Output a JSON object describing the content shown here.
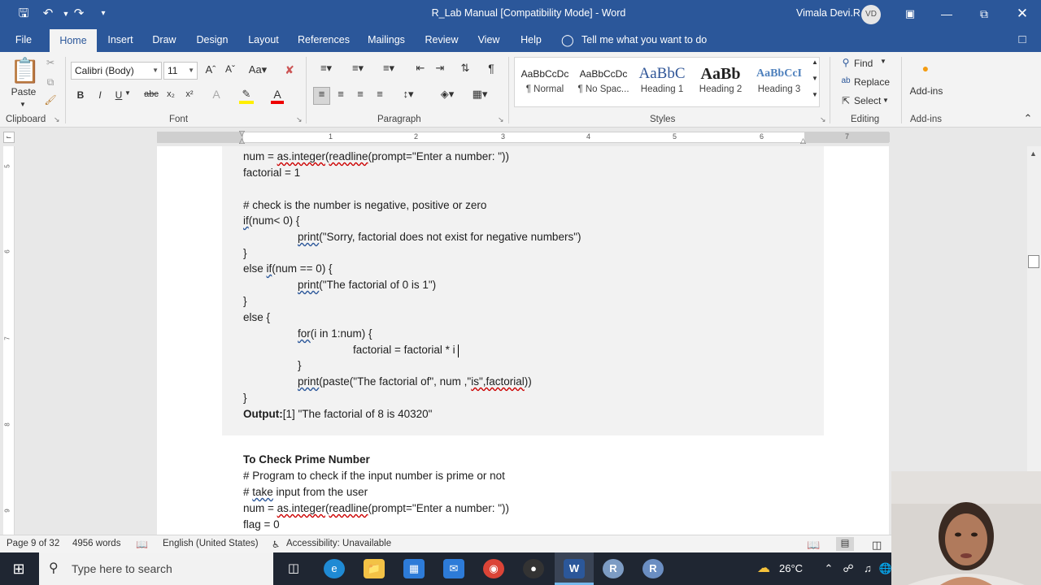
{
  "window": {
    "title": "R_Lab Manual [Compatibility Mode]  -  Word",
    "user_name": "Vimala Devi.R",
    "user_initials": "VD"
  },
  "tabs": [
    "File",
    "Home",
    "Insert",
    "Draw",
    "Design",
    "Layout",
    "References",
    "Mailings",
    "Review",
    "View",
    "Help"
  ],
  "tell_me": "Tell me what you want to do",
  "ribbon": {
    "clipboard": {
      "paste": "Paste",
      "label": "Clipboard"
    },
    "font": {
      "name": "Calibri (Body)",
      "size": "11",
      "label": "Font"
    },
    "paragraph": {
      "label": "Paragraph"
    },
    "styles": {
      "label": "Styles",
      "items": [
        {
          "sample": "AaBbCcDc",
          "name": "¶ Normal"
        },
        {
          "sample": "AaBbCcDc",
          "name": "¶ No Spac..."
        },
        {
          "sample": "AaBbC",
          "name": "Heading 1"
        },
        {
          "sample": "AaBb",
          "name": "Heading 2"
        },
        {
          "sample": "AaBbCcI",
          "name": "Heading 3"
        }
      ]
    },
    "editing": {
      "label": "Editing",
      "find": "Find",
      "replace": "Replace",
      "select": "Select"
    },
    "addins": {
      "button": "Add-ins",
      "label": "Add-ins"
    }
  },
  "ruler_numbers": [
    "1",
    "1",
    "2",
    "3",
    "4",
    "5",
    "6",
    "7"
  ],
  "document": {
    "l1_a": "num = ",
    "l1_b": "as.integer",
    "l1_c": "(",
    "l1_d": "readline",
    "l1_e": "(prompt=\"Enter a number: \"))",
    "l2": "factorial = 1",
    "l3": "# check is the number is negative, positive or zero",
    "l4_a": "if",
    "l4_b": "(num< 0) {",
    "l5_a": "print",
    "l5_b": "(\"Sorry, factorial does not exist for negative numbers\")",
    "l6": "}",
    "l7_a": "else ",
    "l7_b": "if",
    "l7_c": "(num == 0) {",
    "l8_a": "print",
    "l8_b": "(\"The factorial of 0 is 1\")",
    "l9": "}",
    "l10": "else {",
    "l11_a": "for",
    "l11_b": "(i in 1:num) {",
    "l12": "factorial = factorial * i",
    "l13": "}",
    "l14_a": "print",
    "l14_b": "(paste(\"The factorial of\", num ,\"",
    "l14_c": "is\",factorial",
    "l14_d": "))",
    "l15": "}",
    "l16_a": "Output:",
    "l16_b": "[1] \"The factorial of 8 is 40320\"",
    "h2": "To Check Prime Number",
    "p1": "# Program to check if the input number is prime or not",
    "p2_a": "# ",
    "p2_b": "take",
    "p2_c": " input from the user",
    "p3_a": "num = ",
    "p3_b": "as.integer",
    "p3_c": "(",
    "p3_d": "readline",
    "p3_e": "(prompt=\"Enter a number: \"))",
    "p4": "flag = 0"
  },
  "status": {
    "page": "Page 9 of 32",
    "words": "4956 words",
    "language": "English (United States)",
    "accessibility": "Accessibility: Unavailable"
  },
  "taskbar": {
    "search_placeholder": "Type here to search",
    "temperature": "26°C"
  }
}
